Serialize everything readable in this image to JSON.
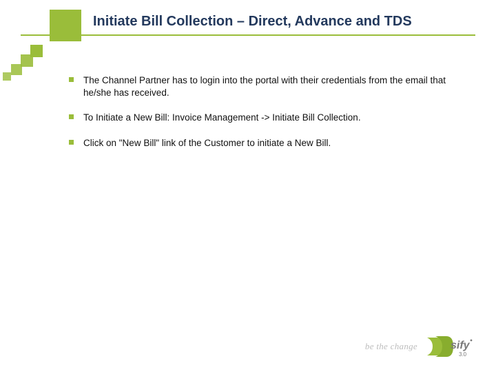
{
  "title": "Initiate Bill Collection – Direct, Advance and TDS",
  "bullets": [
    "The Channel Partner has to login into the portal with their credentials from the email that he/she has received.",
    "To Initiate a New Bill: Invoice Management -> Initiate Bill Collection.",
    "Click on \"New Bill\" link of the Customer to initiate a New Bill."
  ],
  "footer": {
    "tagline": "be the change",
    "brand": "sify",
    "version": "3.0"
  }
}
